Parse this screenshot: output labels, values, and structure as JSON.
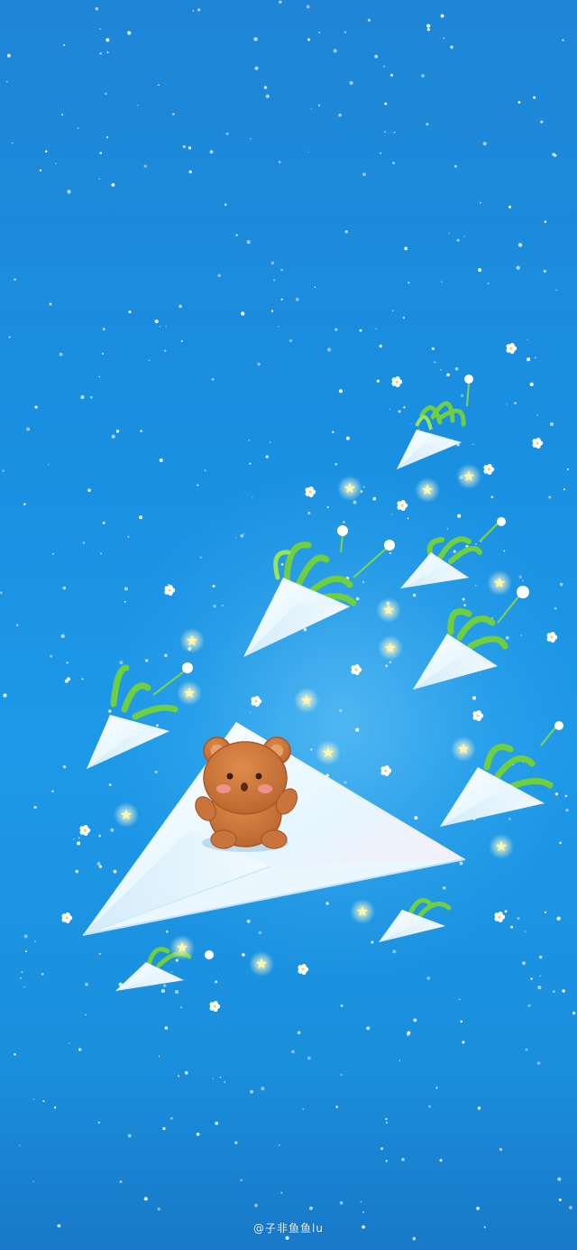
{
  "wallpaper": {
    "watermark": "@子非鱼鱼lu",
    "colors": {
      "sky_top": "#1f86d6",
      "sky_mid": "#1d99e8",
      "plane_white": "#f4fbff",
      "grass_green": "#7fd64a",
      "star_yellow": "#fff6a8",
      "bear_brown": "#c9743a"
    }
  }
}
